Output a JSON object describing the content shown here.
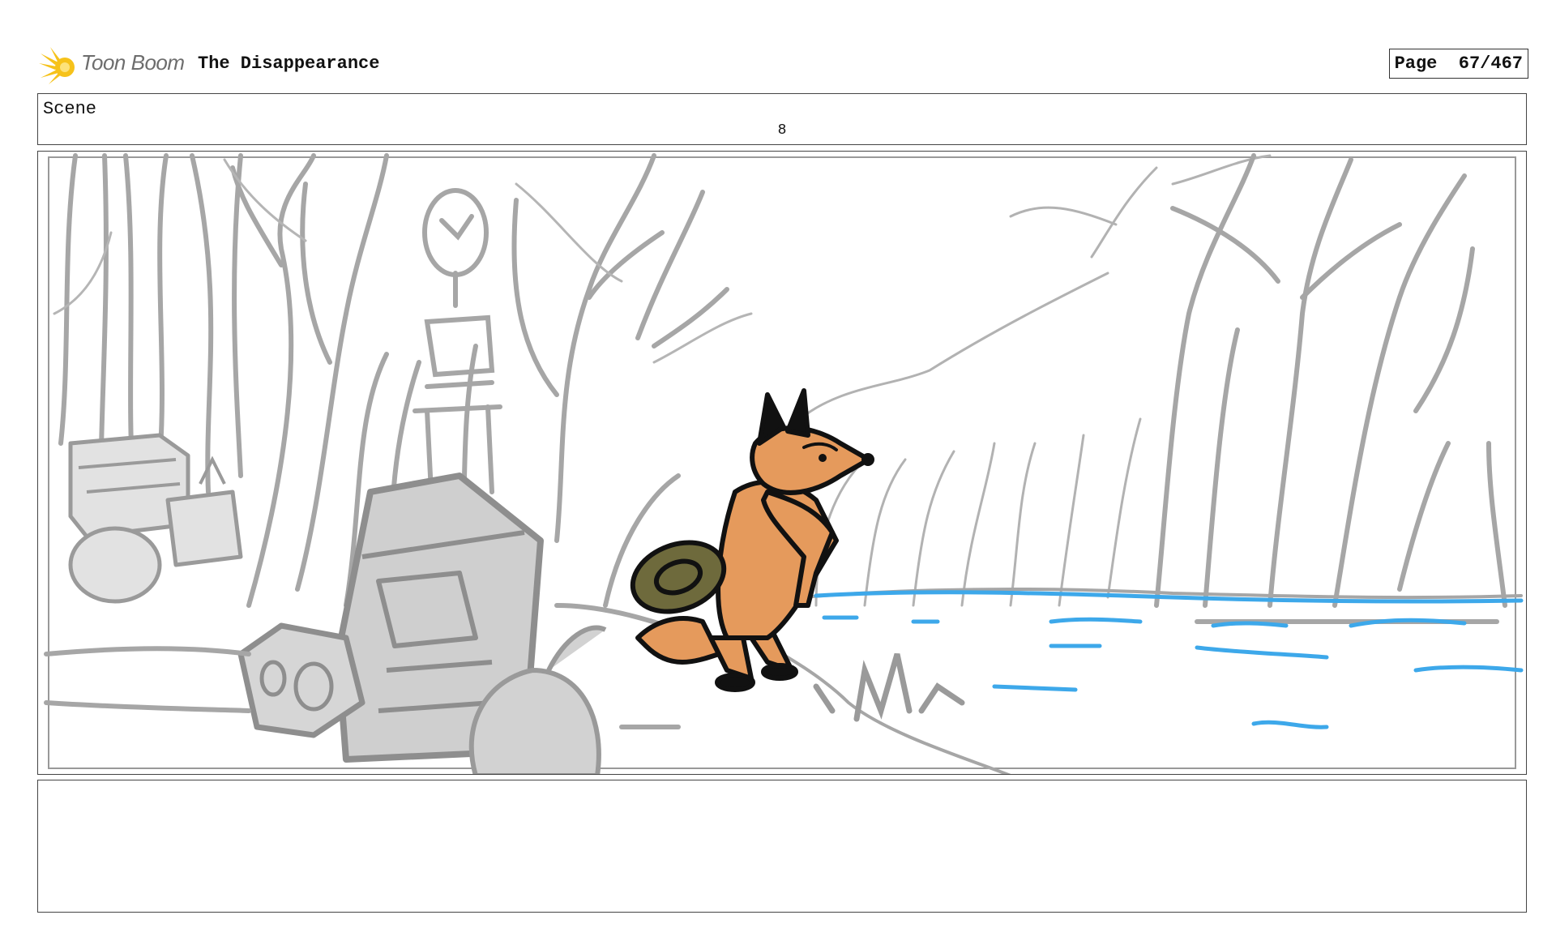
{
  "header": {
    "logo_text": "Toon Boom",
    "project_title": "The Disappearance",
    "page_label": "Page",
    "page_number": "67/467"
  },
  "scene": {
    "label": "Scene",
    "number": "8"
  },
  "panel": {
    "icon": "storyboard-sketch-fox-by-river",
    "colors": {
      "sketch": "#a6a6a6",
      "fox_fill": "#e59a5c",
      "hat_fill": "#6e6a3c",
      "water": "#3da8ea"
    }
  },
  "notes": {
    "text": ""
  }
}
